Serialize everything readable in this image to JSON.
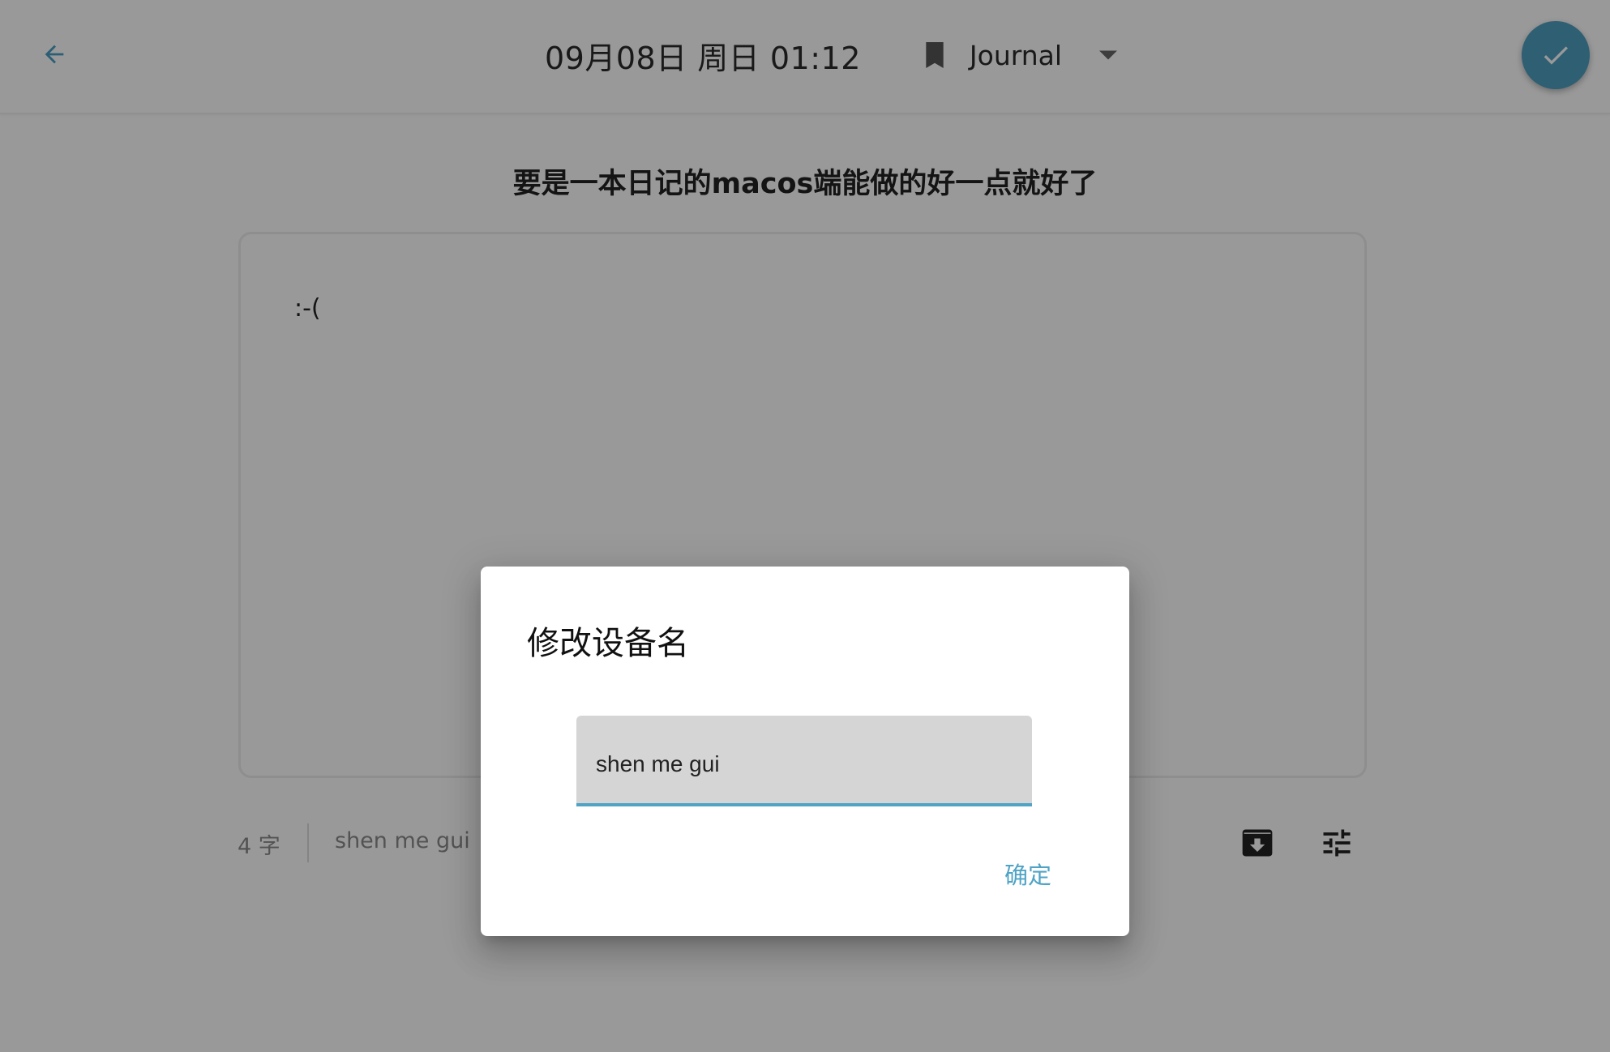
{
  "header": {
    "back_icon": "arrow-left-icon",
    "datetime": "09月08日 周日 01:12",
    "journal": {
      "icon": "bookmark-icon",
      "selected": "Journal",
      "caret_icon": "caret-down-icon"
    },
    "save_icon": "check-icon"
  },
  "entry": {
    "title": "要是一本日记的macos端能做的好一点就好了",
    "body": ":-("
  },
  "footer": {
    "word_count": "4 字",
    "device_name": "shen me gui",
    "archive_icon": "archive-download-icon",
    "settings_icon": "tune-sliders-icon"
  },
  "dialog": {
    "title": "修改设备名",
    "input_value": "shen me gui",
    "confirm_label": "确定"
  },
  "colors": {
    "accent": "#4fa3c5",
    "save_button": "#4f9fc0",
    "scrim": "rgba(0,0,0,0.4)"
  }
}
